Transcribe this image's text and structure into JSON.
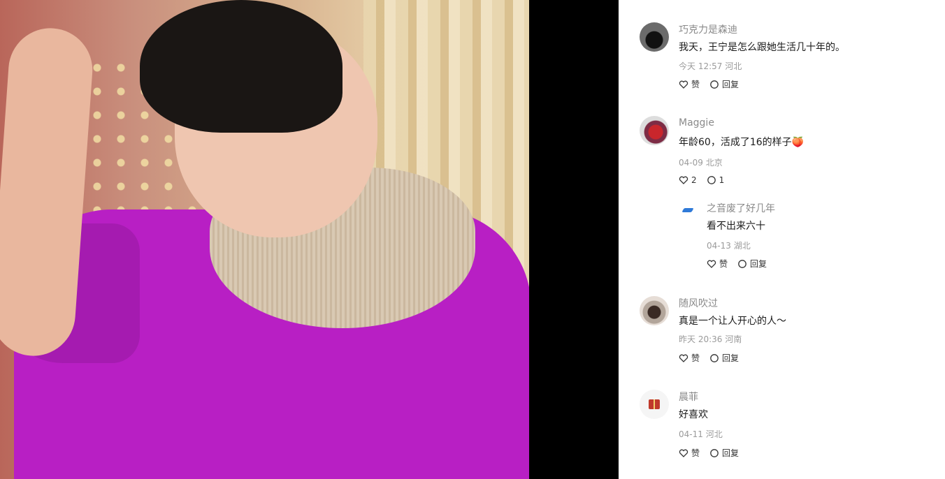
{
  "comments": [
    {
      "username": "巧克力是森迪",
      "text": "我天，王宁是怎么跟她生活几十年的。",
      "time": "今天 12:57",
      "location": "河北",
      "like_label": "赞",
      "reply_label": "回复"
    },
    {
      "username": "Maggie",
      "text": "年龄60，活成了16的样子",
      "emoji": "🍑",
      "time": "04-09",
      "location": "北京",
      "like_count": "2",
      "reply_count": "1",
      "reply": {
        "username": "之音废了好几年",
        "text": "看不出来六十",
        "time": "04-13",
        "location": "湖北",
        "like_label": "赞",
        "reply_label": "回复"
      }
    },
    {
      "username": "随风吹过",
      "text": "真是一个让人开心的人～",
      "time": "昨天 20:36",
      "location": "河南",
      "like_label": "赞",
      "reply_label": "回复"
    },
    {
      "username": "晨菲",
      "text": "好喜欢",
      "time": "04-11",
      "location": "河北",
      "like_label": "赞",
      "reply_label": "回复"
    }
  ]
}
